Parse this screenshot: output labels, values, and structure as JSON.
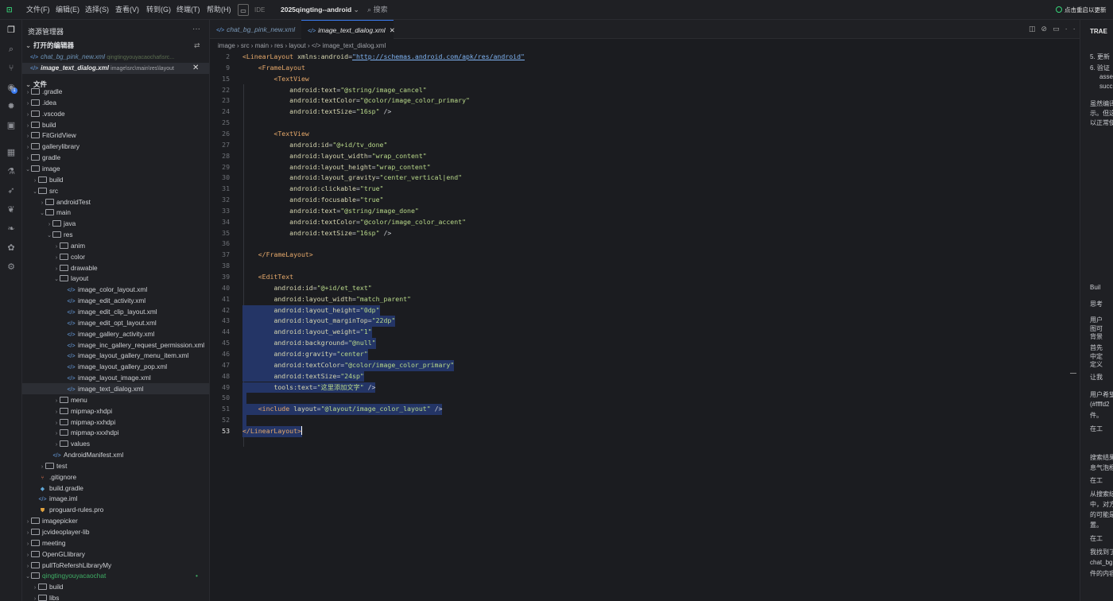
{
  "titlebar": {
    "menus": [
      "文件(F)",
      "编辑(E)",
      "选择(S)",
      "查看(V)",
      "转到(G)",
      "终端(T)",
      "帮助(H)"
    ],
    "ide_label": "IDE",
    "project": "2025qingting--android",
    "search": "搜索",
    "update": "点击重启以更新"
  },
  "sidebar": {
    "title": "资源管理器",
    "open_editors_label": "打开的编辑器",
    "open_editors": [
      {
        "name": "chat_bg_pink_new.xml",
        "path": "qingtingyouyacaochat\\src..."
      },
      {
        "name": "image_text_dialog.xml",
        "path": "image\\src\\main\\res\\layout"
      }
    ],
    "files_label": "文件",
    "tree": [
      {
        "label": ".gradle",
        "depth": 0,
        "kind": "folder",
        "open": false
      },
      {
        "label": ".idea",
        "depth": 0,
        "kind": "folder",
        "open": false
      },
      {
        "label": ".vscode",
        "depth": 0,
        "kind": "folder",
        "open": false
      },
      {
        "label": "build",
        "depth": 0,
        "kind": "folder",
        "open": false
      },
      {
        "label": "FitGridView",
        "depth": 0,
        "kind": "folder",
        "open": false
      },
      {
        "label": "gallerylibrary",
        "depth": 0,
        "kind": "folder",
        "open": false
      },
      {
        "label": "gradle",
        "depth": 0,
        "kind": "folder",
        "open": false
      },
      {
        "label": "image",
        "depth": 0,
        "kind": "folder",
        "open": true
      },
      {
        "label": "build",
        "depth": 1,
        "kind": "folder",
        "open": false
      },
      {
        "label": "src",
        "depth": 1,
        "kind": "folder",
        "open": true
      },
      {
        "label": "androidTest",
        "depth": 2,
        "kind": "folder",
        "open": false
      },
      {
        "label": "main",
        "depth": 2,
        "kind": "folder",
        "open": true
      },
      {
        "label": "java",
        "depth": 3,
        "kind": "folder",
        "open": false
      },
      {
        "label": "res",
        "depth": 3,
        "kind": "folder",
        "open": true
      },
      {
        "label": "anim",
        "depth": 4,
        "kind": "folder",
        "open": false
      },
      {
        "label": "color",
        "depth": 4,
        "kind": "folder",
        "open": false
      },
      {
        "label": "drawable",
        "depth": 4,
        "kind": "folder",
        "open": false
      },
      {
        "label": "layout",
        "depth": 4,
        "kind": "folder",
        "open": true
      },
      {
        "label": "image_color_layout.xml",
        "depth": 5,
        "kind": "xml"
      },
      {
        "label": "image_edit_activity.xml",
        "depth": 5,
        "kind": "xml"
      },
      {
        "label": "image_edit_clip_layout.xml",
        "depth": 5,
        "kind": "xml"
      },
      {
        "label": "image_edit_opt_layout.xml",
        "depth": 5,
        "kind": "xml"
      },
      {
        "label": "image_gallery_activity.xml",
        "depth": 5,
        "kind": "xml"
      },
      {
        "label": "image_inc_gallery_request_permission.xml",
        "depth": 5,
        "kind": "xml"
      },
      {
        "label": "image_layout_gallery_menu_item.xml",
        "depth": 5,
        "kind": "xml"
      },
      {
        "label": "image_layout_gallery_pop.xml",
        "depth": 5,
        "kind": "xml"
      },
      {
        "label": "image_layout_image.xml",
        "depth": 5,
        "kind": "xml"
      },
      {
        "label": "image_text_dialog.xml",
        "depth": 5,
        "kind": "xml",
        "selected": true
      },
      {
        "label": "menu",
        "depth": 4,
        "kind": "folder",
        "open": false
      },
      {
        "label": "mipmap-xhdpi",
        "depth": 4,
        "kind": "folder",
        "open": false
      },
      {
        "label": "mipmap-xxhdpi",
        "depth": 4,
        "kind": "folder",
        "open": false
      },
      {
        "label": "mipmap-xxxhdpi",
        "depth": 4,
        "kind": "folder",
        "open": false
      },
      {
        "label": "values",
        "depth": 4,
        "kind": "folder",
        "open": false
      },
      {
        "label": "AndroidManifest.xml",
        "depth": 3,
        "kind": "xml"
      },
      {
        "label": "test",
        "depth": 2,
        "kind": "folder",
        "open": false
      },
      {
        "label": ".gitignore",
        "depth": 1,
        "kind": "git"
      },
      {
        "label": "build.gradle",
        "depth": 1,
        "kind": "gradle"
      },
      {
        "label": "image.iml",
        "depth": 1,
        "kind": "xml"
      },
      {
        "label": "proguard-rules.pro",
        "depth": 1,
        "kind": "pro"
      },
      {
        "label": "imagepicker",
        "depth": 0,
        "kind": "folder",
        "open": false
      },
      {
        "label": "jcvideoplayer-lib",
        "depth": 0,
        "kind": "folder",
        "open": false
      },
      {
        "label": "meeting",
        "depth": 0,
        "kind": "folder",
        "open": false
      },
      {
        "label": "OpenGLlibrary",
        "depth": 0,
        "kind": "folder",
        "open": false
      },
      {
        "label": "pullToRefershLibraryMy",
        "depth": 0,
        "kind": "folder",
        "open": false
      },
      {
        "label": "qingtingyouyacaochat",
        "depth": 0,
        "kind": "folder",
        "open": true,
        "modified": true
      },
      {
        "label": "build",
        "depth": 1,
        "kind": "folder",
        "open": false
      },
      {
        "label": "libs",
        "depth": 1,
        "kind": "folder",
        "open": false
      }
    ]
  },
  "editor": {
    "tabs": [
      {
        "label": "chat_bg_pink_new.xml",
        "active": false
      },
      {
        "label": "image_text_dialog.xml",
        "active": true
      }
    ],
    "breadcrumbs": [
      "image",
      "src",
      "main",
      "res",
      "layout",
      "image_text_dialog.xml"
    ],
    "lines": [
      {
        "n": "2",
        "hl": false,
        "segs": [
          [
            "tag",
            "<LinearLayout "
          ],
          [
            "attr",
            "xmlns:android"
          ],
          [
            "pun",
            "="
          ],
          [
            "url",
            "\"http://schemas.android.com/apk/res/android\""
          ]
        ]
      },
      {
        "n": "9",
        "hl": false,
        "segs": [
          [
            "pun",
            "    "
          ],
          [
            "tag",
            "<FrameLayout"
          ]
        ]
      },
      {
        "n": "15",
        "hl": false,
        "segs": [
          [
            "pun",
            "        "
          ],
          [
            "tag",
            "<TextView"
          ]
        ]
      },
      {
        "n": "22",
        "hl": false,
        "segs": [
          [
            "pun",
            "            "
          ],
          [
            "attr",
            "android:text"
          ],
          [
            "pun",
            "="
          ],
          [
            "str",
            "\"@string/image_cancel\""
          ]
        ]
      },
      {
        "n": "23",
        "hl": false,
        "segs": [
          [
            "pun",
            "            "
          ],
          [
            "attr",
            "android:textColor"
          ],
          [
            "pun",
            "="
          ],
          [
            "str",
            "\"@color/image_color_primary\""
          ]
        ]
      },
      {
        "n": "24",
        "hl": false,
        "segs": [
          [
            "pun",
            "            "
          ],
          [
            "attr",
            "android:textSize"
          ],
          [
            "pun",
            "="
          ],
          [
            "str",
            "\"16sp\""
          ],
          [
            "pun",
            " />"
          ]
        ]
      },
      {
        "n": "25",
        "hl": false,
        "segs": []
      },
      {
        "n": "26",
        "hl": false,
        "segs": [
          [
            "pun",
            "        "
          ],
          [
            "tag",
            "<TextView"
          ]
        ]
      },
      {
        "n": "27",
        "hl": false,
        "segs": [
          [
            "pun",
            "            "
          ],
          [
            "attr",
            "android:id"
          ],
          [
            "pun",
            "="
          ],
          [
            "str",
            "\"@+id/tv_done\""
          ]
        ]
      },
      {
        "n": "28",
        "hl": false,
        "segs": [
          [
            "pun",
            "            "
          ],
          [
            "attr",
            "android:layout_width"
          ],
          [
            "pun",
            "="
          ],
          [
            "str",
            "\"wrap_content\""
          ]
        ]
      },
      {
        "n": "29",
        "hl": false,
        "segs": [
          [
            "pun",
            "            "
          ],
          [
            "attr",
            "android:layout_height"
          ],
          [
            "pun",
            "="
          ],
          [
            "str",
            "\"wrap_content\""
          ]
        ]
      },
      {
        "n": "30",
        "hl": false,
        "segs": [
          [
            "pun",
            "            "
          ],
          [
            "attr",
            "android:layout_gravity"
          ],
          [
            "pun",
            "="
          ],
          [
            "str",
            "\"center_vertical|end\""
          ]
        ]
      },
      {
        "n": "31",
        "hl": false,
        "segs": [
          [
            "pun",
            "            "
          ],
          [
            "attr",
            "android:clickable"
          ],
          [
            "pun",
            "="
          ],
          [
            "str",
            "\"true\""
          ]
        ]
      },
      {
        "n": "32",
        "hl": false,
        "segs": [
          [
            "pun",
            "            "
          ],
          [
            "attr",
            "android:focusable"
          ],
          [
            "pun",
            "="
          ],
          [
            "str",
            "\"true\""
          ]
        ]
      },
      {
        "n": "33",
        "hl": false,
        "segs": [
          [
            "pun",
            "            "
          ],
          [
            "attr",
            "android:text"
          ],
          [
            "pun",
            "="
          ],
          [
            "str",
            "\"@string/image_done\""
          ]
        ]
      },
      {
        "n": "34",
        "hl": false,
        "segs": [
          [
            "pun",
            "            "
          ],
          [
            "attr",
            "android:textColor"
          ],
          [
            "pun",
            "="
          ],
          [
            "str",
            "\"@color/image_color_accent\""
          ]
        ]
      },
      {
        "n": "35",
        "hl": false,
        "segs": [
          [
            "pun",
            "            "
          ],
          [
            "attr",
            "android:textSize"
          ],
          [
            "pun",
            "="
          ],
          [
            "str",
            "\"16sp\""
          ],
          [
            "pun",
            " />"
          ]
        ]
      },
      {
        "n": "36",
        "hl": false,
        "segs": []
      },
      {
        "n": "37",
        "hl": false,
        "segs": [
          [
            "pun",
            "    "
          ],
          [
            "tag",
            "</FrameLayout>"
          ]
        ]
      },
      {
        "n": "38",
        "hl": false,
        "segs": []
      },
      {
        "n": "39",
        "hl": false,
        "segs": [
          [
            "pun",
            "    "
          ],
          [
            "tag",
            "<EditText"
          ]
        ]
      },
      {
        "n": "40",
        "hl": false,
        "segs": [
          [
            "pun",
            "        "
          ],
          [
            "attr",
            "android:id"
          ],
          [
            "pun",
            "="
          ],
          [
            "str",
            "\"@+id/et_text\""
          ]
        ]
      },
      {
        "n": "41",
        "hl": false,
        "segs": [
          [
            "pun",
            "        "
          ],
          [
            "attr",
            "android:layout_width"
          ],
          [
            "pun",
            "="
          ],
          [
            "str",
            "\"match_parent\""
          ]
        ]
      },
      {
        "n": "42",
        "hl": true,
        "segs": [
          [
            "pun",
            "        "
          ],
          [
            "attr",
            "android:layout_height"
          ],
          [
            "pun",
            "="
          ],
          [
            "str",
            "\"0dp\""
          ]
        ]
      },
      {
        "n": "43",
        "hl": true,
        "segs": [
          [
            "pun",
            "        "
          ],
          [
            "attr",
            "android:layout_marginTop"
          ],
          [
            "pun",
            "="
          ],
          [
            "str",
            "\"22dp\""
          ]
        ]
      },
      {
        "n": "44",
        "hl": true,
        "segs": [
          [
            "pun",
            "        "
          ],
          [
            "attr",
            "android:layout_weight"
          ],
          [
            "pun",
            "="
          ],
          [
            "str",
            "\"1\""
          ]
        ]
      },
      {
        "n": "45",
        "hl": true,
        "segs": [
          [
            "pun",
            "        "
          ],
          [
            "attr",
            "android:background"
          ],
          [
            "pun",
            "="
          ],
          [
            "str",
            "\"@null\""
          ]
        ]
      },
      {
        "n": "46",
        "hl": true,
        "segs": [
          [
            "pun",
            "        "
          ],
          [
            "attr",
            "android:gravity"
          ],
          [
            "pun",
            "="
          ],
          [
            "str",
            "\"center\""
          ]
        ]
      },
      {
        "n": "47",
        "hl": true,
        "segs": [
          [
            "pun",
            "        "
          ],
          [
            "attr",
            "android:textColor"
          ],
          [
            "pun",
            "="
          ],
          [
            "str",
            "\"@color/image_color_primary\""
          ]
        ]
      },
      {
        "n": "48",
        "hl": true,
        "segs": [
          [
            "pun",
            "        "
          ],
          [
            "attr",
            "android:textSize"
          ],
          [
            "pun",
            "="
          ],
          [
            "str",
            "\"24sp\""
          ]
        ]
      },
      {
        "n": "49",
        "hl": true,
        "segs": [
          [
            "pun",
            "        "
          ],
          [
            "attr",
            "tools:text"
          ],
          [
            "pun",
            "="
          ],
          [
            "str",
            "\"这里添加文字\""
          ],
          [
            "pun",
            " />"
          ]
        ]
      },
      {
        "n": "50",
        "hl": true,
        "segs": []
      },
      {
        "n": "51",
        "hl": true,
        "segs": [
          [
            "pun",
            "    "
          ],
          [
            "tag",
            "<include "
          ],
          [
            "attr",
            "layout"
          ],
          [
            "pun",
            "="
          ],
          [
            "str",
            "\"@layout/image_color_layout\""
          ],
          [
            "pun",
            " />"
          ]
        ]
      },
      {
        "n": "52",
        "hl": true,
        "segs": []
      },
      {
        "n": "53",
        "hl": true,
        "cur": true,
        "segs": [
          [
            "tag",
            "</LinearLayout>"
          ]
        ]
      }
    ]
  },
  "right_panel": {
    "title": "TRAE",
    "snippets": [
      "5. 更新",
      "6. 验证",
      "asse",
      "succ",
      "虽然编译",
      "示。但这",
      "以正常使",
      "Buil",
      "思考",
      "用户",
      "图可",
      "背景",
      "首先",
      "中定",
      "定义",
      "让我",
      "用户希望",
      "(#ffffd2",
      "件。",
      "在工",
      "搜索结果",
      "息气泡框",
      "在工",
      "从搜索结",
      "中，对方",
      "的可能是",
      "置。",
      "在工",
      "我找到了",
      "chat_bg",
      "件的内容"
    ]
  },
  "colors": {
    "accent": "#3a7bf0",
    "selection": "#243566",
    "tag": "#e5a86a",
    "string": "#b9d98a",
    "link": "#7fb3f2"
  }
}
